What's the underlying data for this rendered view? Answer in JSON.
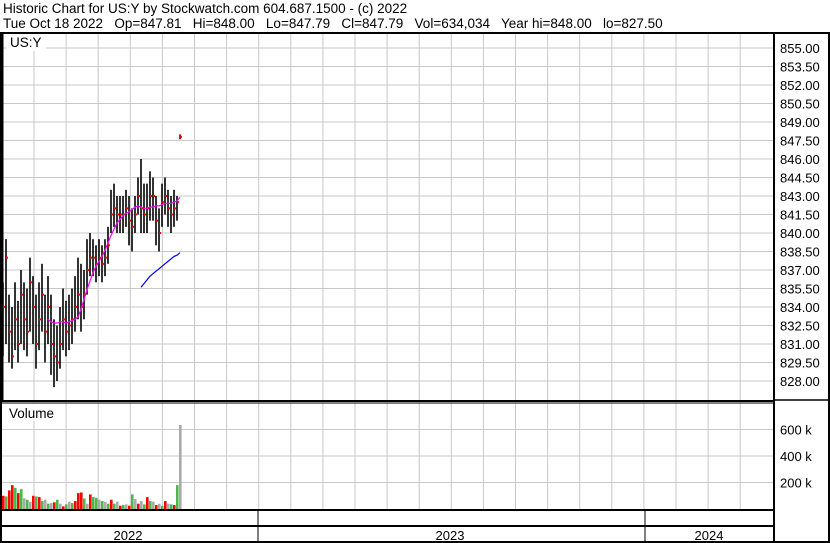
{
  "header": {
    "line1": "Historic Chart for US:Y by Stockwatch.com 604.687.1500 - (c) 2022",
    "line2": "Tue Oct 18 2022   Op=847.81   Hi=848.00   Lo=847.79   Cl=847.79   Vol=634,034   Year hi=848.00   lo=827.50"
  },
  "chart_data": [
    {
      "type": "line",
      "title": "US:Y",
      "ylim": [
        827.0,
        856.0
      ],
      "y_ticks": [
        "855.00",
        "853.50",
        "852.00",
        "850.50",
        "849.00",
        "847.50",
        "846.00",
        "844.50",
        "843.00",
        "841.50",
        "840.00",
        "838.50",
        "837.00",
        "835.50",
        "834.00",
        "832.50",
        "831.00",
        "829.50",
        "828.00"
      ],
      "grid": true,
      "close": [
        834,
        838,
        832,
        830,
        833,
        831,
        835,
        833,
        832,
        836,
        834,
        831,
        833,
        835,
        832,
        834,
        831,
        830,
        829.5,
        831,
        833,
        832,
        832.5,
        833,
        834,
        835,
        834,
        835,
        837,
        838,
        838,
        837.5,
        838,
        837.5,
        838,
        839,
        841.5,
        842,
        841.5,
        841.5,
        841.5,
        842,
        841,
        840.5,
        841.5,
        843,
        842,
        841.5,
        842,
        843,
        843,
        841,
        840,
        842.5,
        843,
        842,
        841.5,
        842,
        842.5,
        847.8
      ],
      "high": [
        836,
        839.5,
        835,
        834,
        836,
        834.5,
        837,
        836,
        835.5,
        838,
        836.5,
        835,
        836,
        837.5,
        835,
        836.5,
        835,
        833,
        832.5,
        834,
        835.5,
        834.5,
        835,
        835.5,
        836.5,
        838,
        837.5,
        837,
        839.5,
        840,
        839.5,
        839,
        839.5,
        839,
        839.5,
        840.5,
        843.5,
        844,
        843,
        843,
        843,
        843.5,
        843,
        842,
        843,
        844.5,
        846,
        844,
        844,
        845,
        844.5,
        843,
        842,
        844,
        844.5,
        843.5,
        843,
        843.5,
        843,
        848
      ],
      "low": [
        830,
        831,
        829.5,
        829,
        830.5,
        829.5,
        831,
        830.5,
        830,
        832,
        831,
        829,
        830.5,
        832,
        829.5,
        831,
        828.5,
        827.5,
        828,
        829,
        830.5,
        830,
        830.5,
        831,
        832,
        833,
        832,
        833,
        835,
        836.5,
        836.5,
        836,
        836.5,
        836,
        836.5,
        837.5,
        840,
        840.5,
        840,
        840,
        840,
        840.5,
        839,
        838.5,
        840,
        841.5,
        840,
        840,
        840,
        841,
        841,
        839,
        838.5,
        840.5,
        841.5,
        840.5,
        840,
        840.5,
        841,
        847.6
      ],
      "series": [
        {
          "name": "MA 20",
          "color": "#ff00ff",
          "start_index": 15,
          "values": [
            833,
            832.8,
            832.7,
            832.7,
            832.8,
            832.8,
            832.7,
            832.8,
            832.9,
            833,
            833.2,
            833.8,
            834.6,
            835.4,
            836.1,
            836.8,
            837.3,
            837.7,
            838.1,
            838.6,
            839.2,
            839.8,
            840.3,
            840.8,
            841.1,
            841.4,
            841.6,
            841.7,
            841.9,
            842.1,
            842.2,
            842.1,
            842,
            842,
            842.1,
            842.1,
            842.2,
            842.2,
            842.3,
            842.4,
            842.4,
            842.4,
            842.5,
            842.6,
            842.9
          ]
        },
        {
          "name": "MA 50",
          "color": "#0000ff",
          "start_index": 46,
          "values": [
            835.6,
            835.9,
            836.2,
            836.5,
            836.7,
            836.9,
            837.1,
            837.3,
            837.5,
            837.7,
            837.9,
            838.1,
            838.2,
            838.4
          ]
        }
      ]
    },
    {
      "type": "bar",
      "title": "Volume",
      "y_ticks": [
        "600 k",
        "400 k",
        "200 k"
      ],
      "ylim": [
        0,
        700000
      ],
      "values": [
        100,
        95,
        140,
        180,
        160,
        120,
        150,
        80,
        70,
        55,
        100,
        95,
        90,
        60,
        70,
        40,
        45,
        50,
        70,
        40,
        20,
        35,
        55,
        45,
        60,
        120,
        125,
        80,
        40,
        110,
        90,
        85,
        70,
        60,
        55,
        40,
        70,
        40,
        55,
        25,
        30,
        35,
        25,
        110,
        75,
        40,
        60,
        35,
        90,
        60,
        55,
        30,
        40,
        25,
        60,
        40,
        35,
        30,
        180,
        634
      ],
      "colors": [
        "r",
        "g",
        "r",
        "r",
        "g",
        "r",
        "g",
        "x",
        "g",
        "x",
        "r",
        "g",
        "r",
        "g",
        "x",
        "g",
        "x",
        "r",
        "g",
        "x",
        "r",
        "g",
        "x",
        "g",
        "r",
        "r",
        "r",
        "g",
        "x",
        "r",
        "g",
        "g",
        "x",
        "g",
        "x",
        "g",
        "r",
        "g",
        "x",
        "r",
        "g",
        "x",
        "r",
        "g",
        "x",
        "r",
        "x",
        "g",
        "r",
        "g",
        "x",
        "r",
        "x",
        "g",
        "r",
        "x",
        "g",
        "r",
        "g",
        "x"
      ]
    }
  ],
  "volume_label": "Volume",
  "years": [
    "2022",
    "2023",
    "2024"
  ]
}
